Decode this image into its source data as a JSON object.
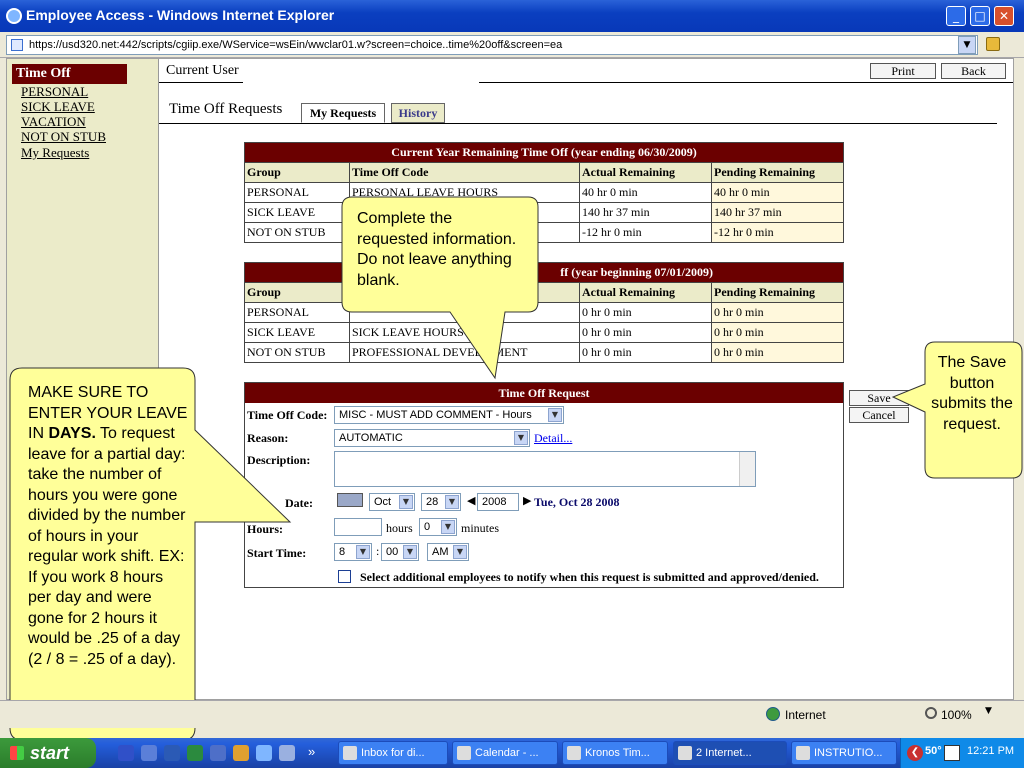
{
  "window": {
    "title": "Employee Access - Windows Internet Explorer",
    "url": "https://usd320.net:442/scripts/cgiip.exe/WService=wsEin/wwclar01.w?screen=choice..time%20off&screen=ea"
  },
  "sidebar": {
    "header": "Time Off",
    "items": [
      "PERSONAL",
      "SICK LEAVE",
      "VACATION",
      "NOT ON STUB",
      "My Requests"
    ]
  },
  "topbar": {
    "current_user_label": "Current User",
    "print_label": "Print",
    "back_label": "Back"
  },
  "page": {
    "title": "Time Off Requests",
    "tabs": [
      "My Requests",
      "History"
    ]
  },
  "current_year": {
    "caption": "Current Year Remaining Time Off (year ending 06/30/2009)",
    "headers": [
      "Group",
      "Time Off Code",
      "Actual Remaining",
      "Pending Remaining"
    ],
    "rows": [
      [
        "PERSONAL",
        "PERSONAL LEAVE HOURS",
        "40 hr 0 min",
        "40 hr 0 min"
      ],
      [
        "SICK LEAVE",
        "",
        "140 hr 37 min",
        "140 hr 37 min"
      ],
      [
        "NOT ON STUB",
        "",
        "-12 hr 0 min",
        "-12 hr 0 min"
      ]
    ]
  },
  "next_year": {
    "caption": "ff (year beginning 07/01/2009)",
    "headers": [
      "Group",
      "",
      "Actual Remaining",
      "Pending Remaining"
    ],
    "rows": [
      [
        "PERSONAL",
        "",
        "0 hr 0 min",
        "0 hr 0 min"
      ],
      [
        "SICK LEAVE",
        "SICK LEAVE HOURS",
        "0 hr 0 min",
        "0 hr 0 min"
      ],
      [
        "NOT ON STUB",
        "PROFESSIONAL DEVEL    MENT",
        "0 hr 0 min",
        "0 hr 0 min"
      ]
    ]
  },
  "request_form": {
    "caption": "Time Off Request",
    "time_off_code_label": "Time Off Code:",
    "time_off_code_value": "MISC - MUST ADD COMMENT - Hours",
    "reason_label": "Reason:",
    "reason_value": "AUTOMATIC",
    "detail_link": "Detail...",
    "description_label": "Description:",
    "date_label": "Date:",
    "month": "Oct",
    "day": "28",
    "year": "2008",
    "date_text": "Tue, Oct 28 2008",
    "hours_label": "Hours:",
    "hours_unit": "hours",
    "minutes_value": "0",
    "minutes_unit": "minutes",
    "start_time_label": "Start Time:",
    "start_hour": "8",
    "start_minute": "00",
    "start_ampm": "AM",
    "notify_label": "Select additional employees to notify when this request is submitted and approved/denied.",
    "save_label": "Save",
    "cancel_label": "Cancel"
  },
  "callouts": {
    "blank_note": "Complete the requested information.  Do not leave anything blank.",
    "save_note": "The Save button submits the request.",
    "days_note_pre": "MAKE SURE TO ENTER YOUR LEAVE IN ",
    "days_note_bold": "DAYS.",
    "days_note_post": "To request leave for a partial day: take the number of hours you were gone divided by the number of hours in your regular work shift.  EX:  If you work 8 hours per day and were gone for 2 hours it would be .25 of a day (2 / 8 = .25 of a day)."
  },
  "statusbar": {
    "zone": "Internet",
    "zoom": "100%"
  },
  "taskbar": {
    "start": "start",
    "tasks": [
      "Inbox for di...",
      "Calendar - ...",
      "Kronos Tim...",
      "2 Internet...",
      "INSTRUTIO..."
    ],
    "temperature": "50°",
    "clock": "12:21 PM"
  },
  "colors": {
    "header_maroon": "#6b0000",
    "nav_bg": "#ebebc9",
    "callout_yellow": "#ffff99",
    "xp_blue": "#245edb"
  }
}
